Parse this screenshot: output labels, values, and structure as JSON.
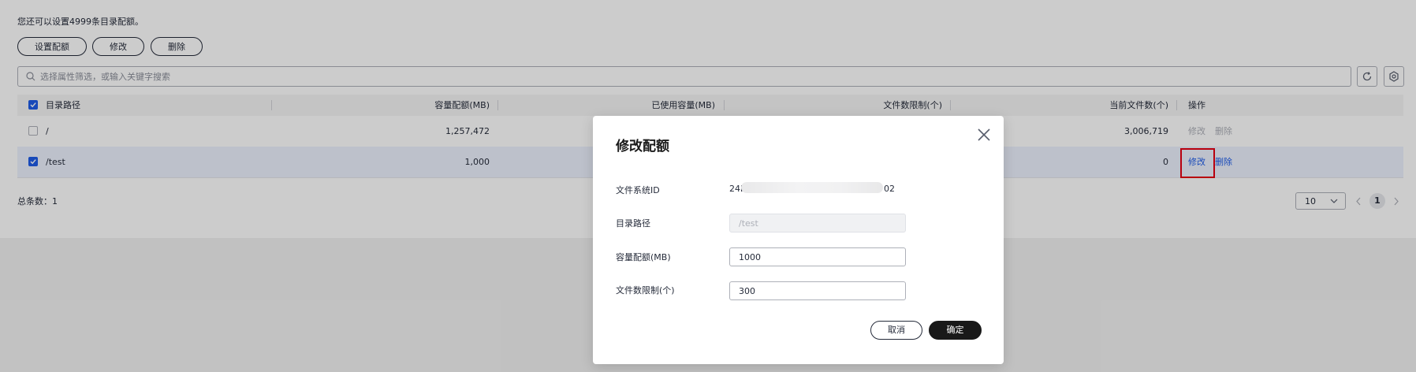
{
  "header": {
    "notice": "您还可以设置4999条目录配额。"
  },
  "toolbar": {
    "set_quota_label": "设置配额",
    "modify_label": "修改",
    "delete_label": "删除"
  },
  "search": {
    "placeholder": "选择属性筛选，或输入关键字搜索"
  },
  "table": {
    "columns": [
      "目录路径",
      "容量配额(MB)",
      "已使用容量(MB)",
      "文件数限制(个)",
      "当前文件数(个)",
      "操作"
    ],
    "rows": [
      {
        "path": "/",
        "capacity_quota": "1,257,472",
        "current_files": "3,006,719",
        "checked": false,
        "action_modify": "修改",
        "action_delete": "删除"
      },
      {
        "path": "/test",
        "capacity_quota": "1,000",
        "current_files": "0",
        "checked": true,
        "action_modify": "修改",
        "action_delete": "删除"
      }
    ]
  },
  "footer": {
    "total_label": "总条数：",
    "total_count": "1"
  },
  "pagination": {
    "page_size": "10",
    "current_page": "1"
  },
  "dialog": {
    "title": "修改配额",
    "fs_id_label": "文件系统ID",
    "fs_id_prefix": "24b",
    "fs_id_suffix": "02",
    "dir_path_label": "目录路径",
    "dir_path_value": "/test",
    "capacity_label": "容量配额(MB)",
    "capacity_value": "1000",
    "file_limit_label": "文件数限制(个)",
    "file_limit_value": "300",
    "cancel_label": "取消",
    "confirm_label": "确定"
  },
  "colors": {
    "accent": "#1e5ce8",
    "highlight_box": "#e60012",
    "primary_button": "#191919"
  },
  "icons": [
    "search-icon",
    "refresh-icon",
    "settings-icon",
    "close-icon",
    "chevron-down-icon",
    "chevron-left-icon",
    "chevron-right-icon",
    "checkbox-icon"
  ]
}
